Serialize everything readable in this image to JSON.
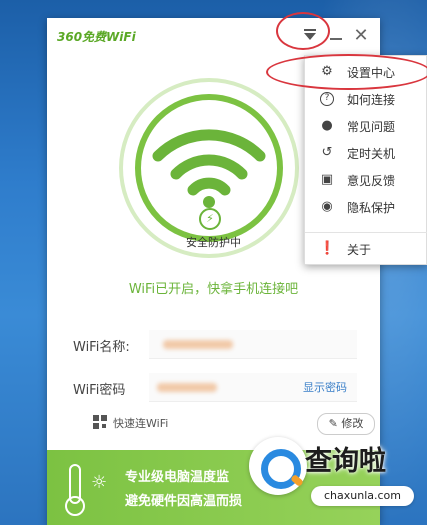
{
  "app": {
    "logo": "360免费WiFi"
  },
  "titlebar": {
    "menu_icon": "dropdown-menu-icon",
    "min_icon": "minimize-icon",
    "close_icon": "close-icon"
  },
  "status": {
    "safe_label": "安全防护中",
    "wifi_status": "WiFi已开启，快拿手机连接吧"
  },
  "fields": {
    "name_label": "WiFi名称:",
    "password_label": "WiFi密码",
    "show_password": "显示密码"
  },
  "quick": {
    "label": "快速连WiFi",
    "edit_button": "修改"
  },
  "banner": {
    "line1": "专业级电脑温度监",
    "line2": "避免硬件因高温而损"
  },
  "menu": {
    "items": [
      {
        "label": "设置中心",
        "icon": "gear-icon"
      },
      {
        "label": "如何连接",
        "icon": "question-icon"
      },
      {
        "label": "常见问题",
        "icon": "chat-bubble-icon"
      },
      {
        "label": "定时关机",
        "icon": "timer-icon"
      },
      {
        "label": "意见反馈",
        "icon": "feedback-icon"
      },
      {
        "label": "隐私保护",
        "icon": "privacy-icon"
      },
      {
        "label": "关于",
        "icon": "info-icon"
      }
    ]
  },
  "watermark": {
    "title": "查询啦",
    "url": "chaxunla.com"
  },
  "colors": {
    "accent_green": "#7cc242",
    "link_blue": "#3a7fc8",
    "annotation_red": "#d9363e"
  }
}
